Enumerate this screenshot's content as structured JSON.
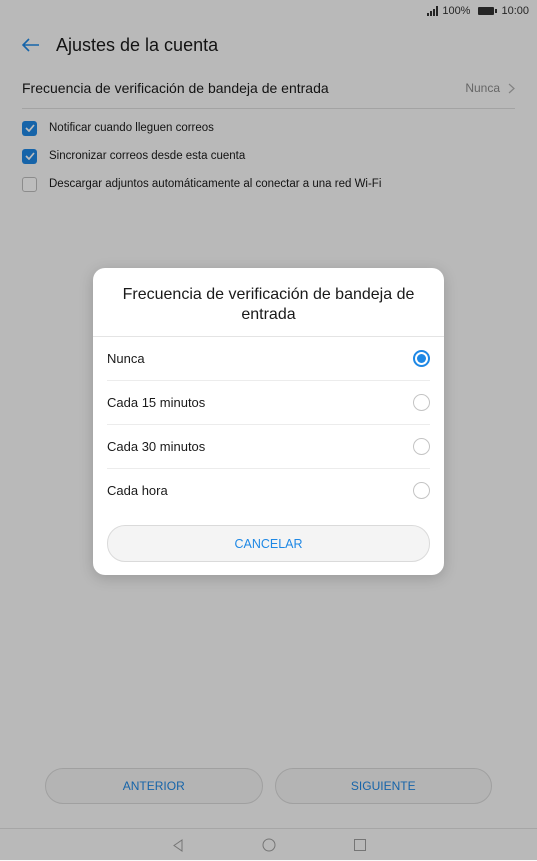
{
  "status_bar": {
    "signal": "signal-icon",
    "battery_text": "100%",
    "time": "10:00"
  },
  "header": {
    "title": "Ajustes de la cuenta"
  },
  "settings": {
    "frequency_label": "Frecuencia de verificación de bandeja de entrada",
    "frequency_value": "Nunca",
    "checkboxes": [
      {
        "label": "Notificar cuando lleguen correos",
        "checked": true
      },
      {
        "label": "Sincronizar correos desde esta cuenta",
        "checked": true
      },
      {
        "label": "Descargar adjuntos automáticamente al conectar a una red Wi-Fi",
        "checked": false
      }
    ]
  },
  "footer": {
    "prev_label": "ANTERIOR",
    "next_label": "SIGUIENTE"
  },
  "dialog": {
    "title": "Frecuencia de verificación de bandeja de entrada",
    "options": [
      {
        "label": "Nunca",
        "selected": true
      },
      {
        "label": "Cada 15 minutos",
        "selected": false
      },
      {
        "label": "Cada 30 minutos",
        "selected": false
      },
      {
        "label": "Cada hora",
        "selected": false
      }
    ],
    "cancel_label": "CANCELAR"
  },
  "colors": {
    "accent": "#1e88e5",
    "overlay": "rgba(0,0,0,0.26)"
  }
}
